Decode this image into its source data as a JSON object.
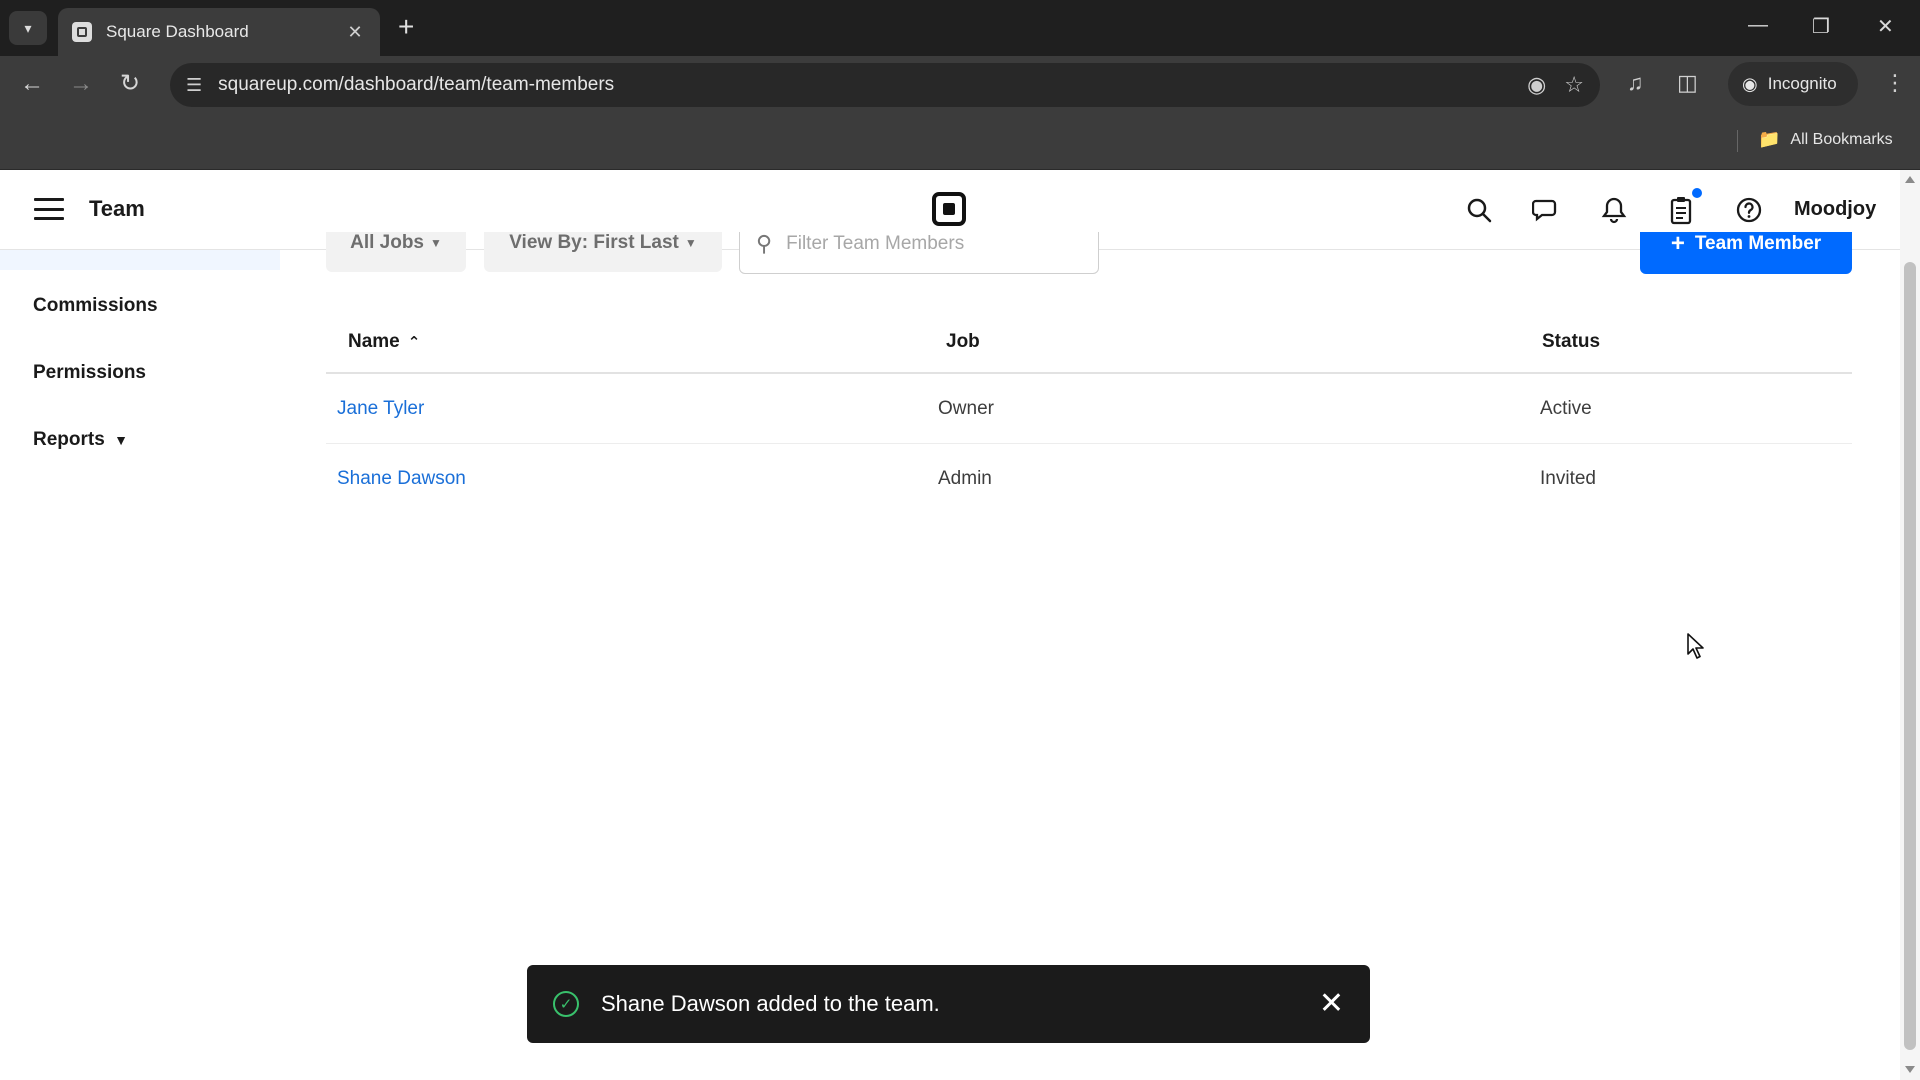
{
  "browser": {
    "tab_title": "Square Dashboard",
    "url": "squareup.com/dashboard/team/team-members",
    "incognito_label": "Incognito",
    "bookmarks_label": "All Bookmarks"
  },
  "header": {
    "title": "Team",
    "account_name": "Moodjoy"
  },
  "sidebar": {
    "items": [
      {
        "label": "Commissions"
      },
      {
        "label": "Permissions"
      },
      {
        "label": "Reports"
      }
    ]
  },
  "filters": {
    "jobs_label": "All Jobs",
    "view_by_label": "View By: First Last",
    "search_placeholder": "Filter Team Members",
    "add_button_label": "Team Member"
  },
  "table": {
    "headers": {
      "name": "Name",
      "job": "Job",
      "status": "Status"
    },
    "rows": [
      {
        "name": "Jane Tyler",
        "job": "Owner",
        "status": "Active"
      },
      {
        "name": "Shane Dawson",
        "job": "Admin",
        "status": "Invited"
      }
    ]
  },
  "toast": {
    "message": "Shane Dawson added to the team."
  },
  "colors": {
    "accent": "#006aff",
    "link": "#1a6fd8",
    "success": "#39c16c"
  }
}
